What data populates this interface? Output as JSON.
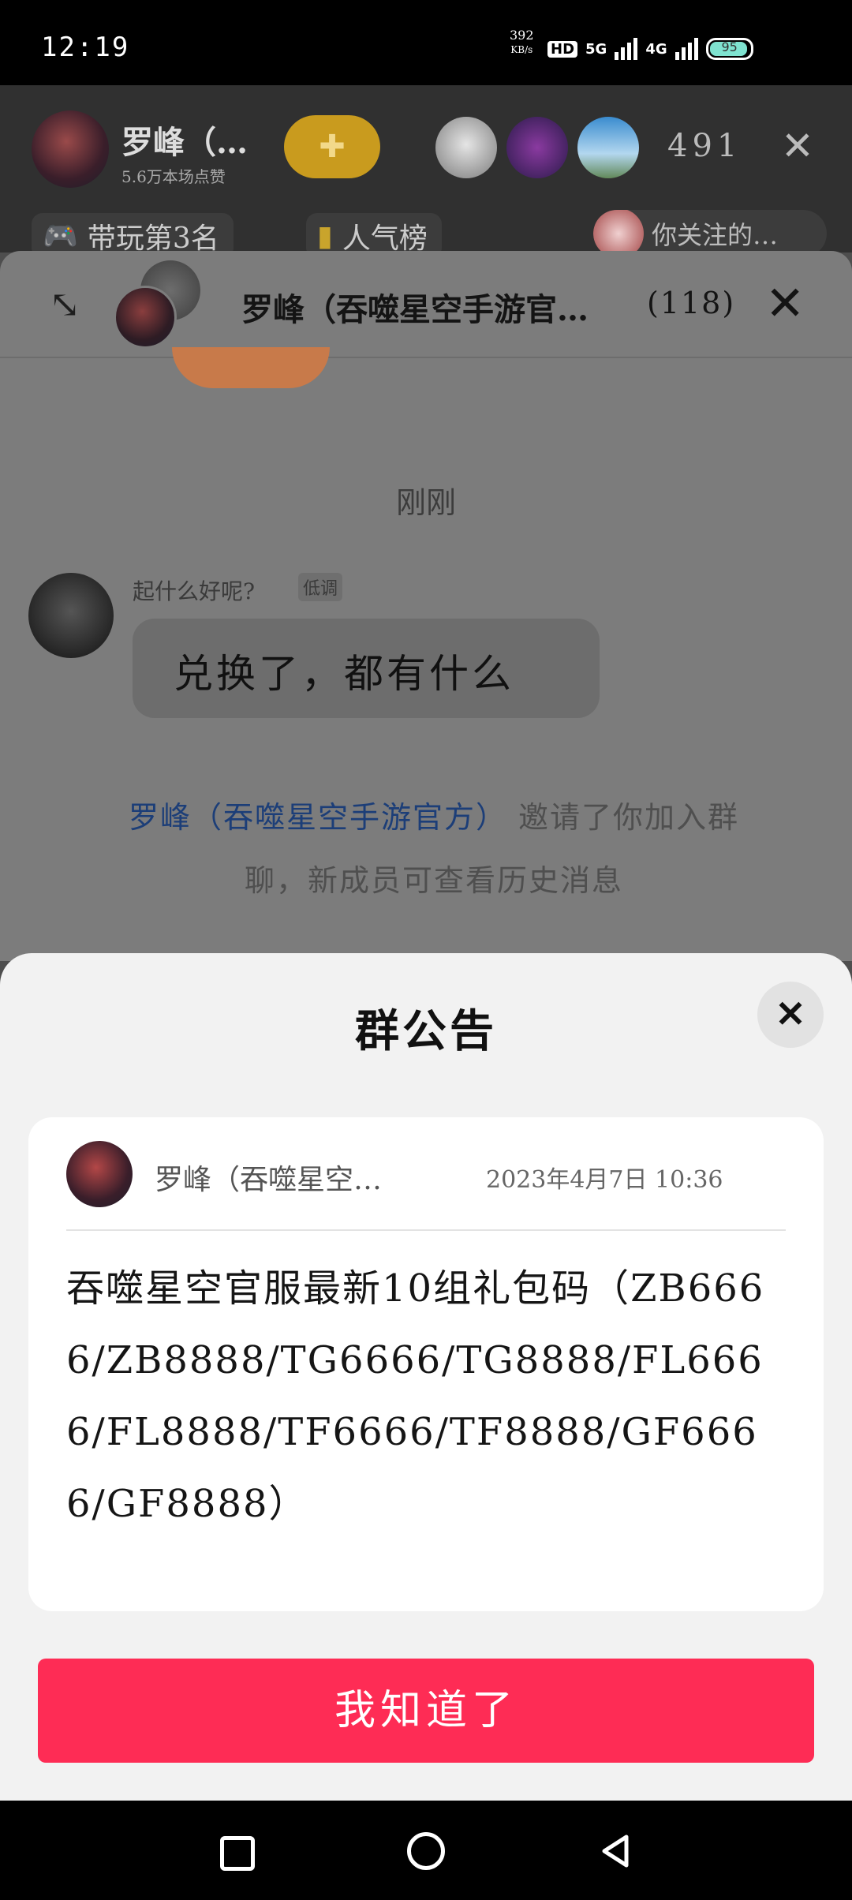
{
  "status_bar": {
    "time": "12:19",
    "net_speed_value": "392",
    "net_speed_unit": "KB/s",
    "hd_label": "HD",
    "network_1": "5G",
    "network_2": "4G",
    "battery_level": "95"
  },
  "live": {
    "host_name": "罗峰（…",
    "host_likes": "5.6万本场点赞",
    "viewer_count": "491",
    "rank_label": "带玩第3名",
    "popularity_label": "人气榜",
    "followed_label": "你关注的…"
  },
  "chat": {
    "title": "罗峰（吞噬星空手游官…",
    "member_count": "(118)",
    "time_divider": "刚刚",
    "sender_name": "起什么好呢?",
    "sender_badge": "低调",
    "message": "兑换了，都有什么",
    "system_inviter": "罗峰（吞噬星空手游官方）",
    "system_text": "邀请了你加入群聊，新成员可查看历史消息"
  },
  "announcement": {
    "title": "群公告",
    "author": "罗峰（吞噬星空…",
    "posted_at": "2023年4月7日 10:36",
    "body": "吞噬星空官服最新10组礼包码（ZB6666/ZB8888/TG6666/TG8888/FL6666/FL8888/TF6666/TF8888/GF6666/GF8888）",
    "confirm_label": "我知道了"
  },
  "colors": {
    "accent": "#fe2c55",
    "link": "#1c3e78"
  }
}
